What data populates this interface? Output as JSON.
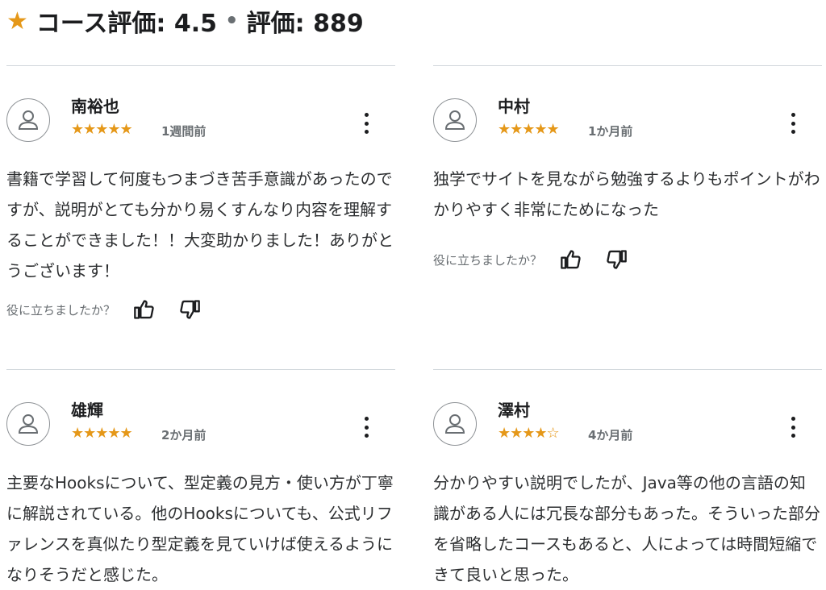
{
  "header": {
    "star": "★",
    "course_rating_label": "コース評価: 4.5",
    "separator": "•",
    "ratings_count_label": "評価: 889"
  },
  "helpful_prompt": "役に立ちましたか？",
  "reviews": [
    {
      "name": "南裕也",
      "stars": 5,
      "stars_filled": "★★★★★",
      "stars_empty": "",
      "date": "1週間前",
      "body": "書籍で学習して何度もつまづき苦手意識があったのですが、説明がとても分かり易くすんなり内容を理解することができました！！大変助かりました！ありがとうございます！"
    },
    {
      "name": "中村",
      "stars": 5,
      "stars_filled": "★★★★★",
      "stars_empty": "",
      "date": "1か月前",
      "body": "独学でサイトを見ながら勉強するよりもポイントがわかりやすく非常にためになった"
    },
    {
      "name": "雄輝",
      "stars": 5,
      "stars_filled": "★★★★★",
      "stars_empty": "",
      "date": "2か月前",
      "body": "主要なHooksについて、型定義の見方・使い方が丁寧に解説されている。他のHooksについても、公式リファレンスを真似たり型定義を見ていけば使えるようになりそうだと感じた。"
    },
    {
      "name": "澤村",
      "stars": 4,
      "stars_filled": "★★★★",
      "stars_empty": "☆",
      "date": "4か月前",
      "body": "分かりやすい説明でしたが、Java等の他の言語の知識がある人には冗長な部分もあった。そういった部分を省略したコースもあると、人によっては時間短縮できて良いと思った。"
    }
  ],
  "colors": {
    "star": "#e59819",
    "text": "#1c1d1f",
    "muted": "#6a6f73",
    "divider": "#d1d7dc"
  }
}
